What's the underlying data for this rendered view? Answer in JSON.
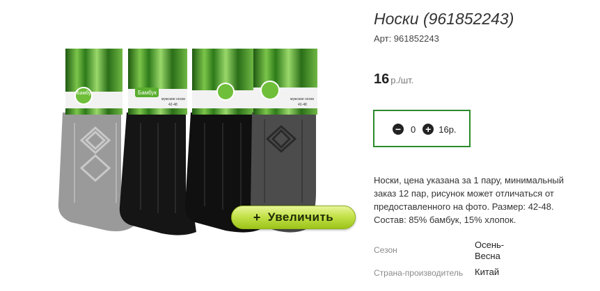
{
  "product": {
    "title": "Носки (961852243)",
    "sku": "Арт: 961852243",
    "price_value": "16",
    "price_unit": "р./шт.",
    "zoom_button": {
      "icon": "plus-icon",
      "label": "Увеличить"
    },
    "quantity": {
      "minus_icon": "minus-circle-icon",
      "value": "0",
      "plus_icon": "plus-circle-icon",
      "sum": "16р.",
      "border_color": "#2a8a2a"
    },
    "description": "Носки, цена указана за 1 пару, минимальный заказ 12 пар, рисунок может отличаться от предоставленного на фото. Размер: 42-48. Состав: 85% бамбук, 15% хлопок.",
    "attributes": [
      {
        "label": "Сезон",
        "value": "Осень-Весна"
      },
      {
        "label": "Страна-производитель",
        "value": "Китай"
      }
    ],
    "image": {
      "pack_label": "Бамбук",
      "pack_text": "мужские носки",
      "pack_size": "42-48"
    }
  }
}
